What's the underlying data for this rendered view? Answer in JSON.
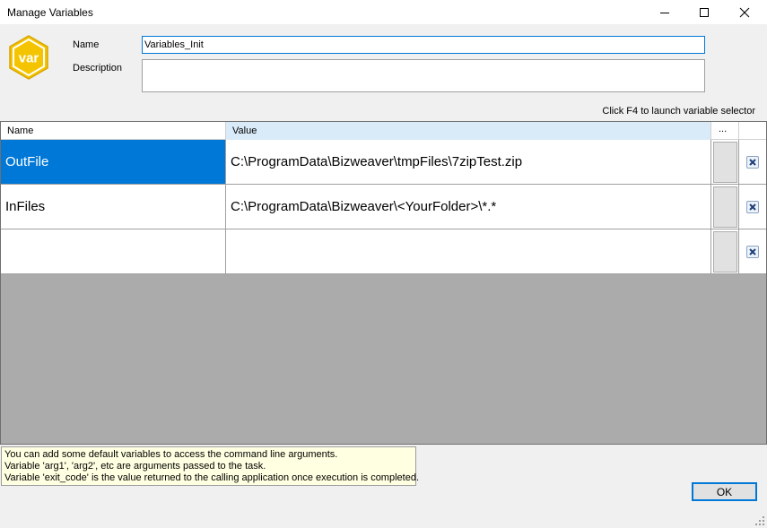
{
  "window": {
    "title": "Manage Variables"
  },
  "logo": {
    "text": "var",
    "color": "#f5c400"
  },
  "form": {
    "name_label": "Name",
    "name_value": "Variables_Init",
    "description_label": "Description",
    "description_value": ""
  },
  "grid": {
    "hint": "Click F4 to launch variable selector",
    "columns": {
      "name": "Name",
      "value": "Value",
      "dots": "..."
    },
    "rows": [
      {
        "name": "OutFile",
        "value": "C:\\ProgramData\\Bizweaver\\tmpFiles\\7zipTest.zip",
        "selected": true
      },
      {
        "name": "InFiles",
        "value": "C:\\ProgramData\\Bizweaver\\<YourFolder>\\*.*",
        "selected": false
      },
      {
        "name": "",
        "value": "",
        "selected": false
      }
    ]
  },
  "tooltip": {
    "lines": [
      "You can add some default variables to access the command line arguments.",
      "Variable 'arg1', 'arg2', etc are arguments passed to the task.",
      "Variable 'exit_code' is the value returned to the calling application once execution is completed."
    ]
  },
  "buttons": {
    "ok": "OK"
  },
  "colors": {
    "accent": "#0078d7",
    "grid_empty": "#ababab",
    "tooltip_bg": "#ffffe1"
  }
}
